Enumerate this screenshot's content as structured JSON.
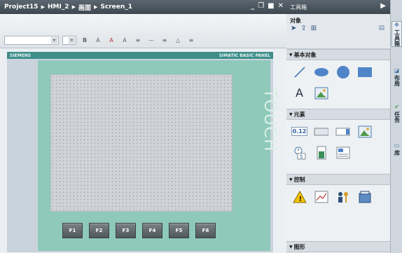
{
  "editor": {
    "breadcrumb": [
      "Project15",
      "HMI_2",
      "画面",
      "Screen_1"
    ],
    "window_controls": [
      "_",
      "❐",
      "■",
      "✕"
    ]
  },
  "toolbar": {
    "font_combo_arrow": "▾",
    "bold_label": "B",
    "buttons": [
      "A",
      "A",
      "A",
      "≡",
      "—",
      "≡",
      "△",
      "≡"
    ]
  },
  "panel": {
    "brand": "SIEMENS",
    "model": "SIMATIC BASIC PANEL",
    "touch_label": "TOUCH",
    "function_keys": [
      "F1",
      "F2",
      "F3",
      "F4",
      "F5",
      "F6"
    ]
  },
  "toolbox": {
    "title": "工具箱",
    "objects_label": "对象",
    "sections": {
      "basic": "基本对象",
      "elements": "元素",
      "controls": "控制",
      "graphics": "图形"
    },
    "basic_text_icon": "A",
    "io_field_icon": "0.12"
  },
  "sidetabs": [
    {
      "icon": "toolbox-icon",
      "label": "工具箱"
    },
    {
      "icon": "layout-icon",
      "label": "布局"
    },
    {
      "icon": "tasks-icon",
      "label": "任务"
    },
    {
      "icon": "library-icon",
      "label": "库"
    }
  ],
  "colors": {
    "title_bar": "#4a545d",
    "panel_teal": "#8ec9b9",
    "siemens_bar": "#3e8e8a"
  }
}
